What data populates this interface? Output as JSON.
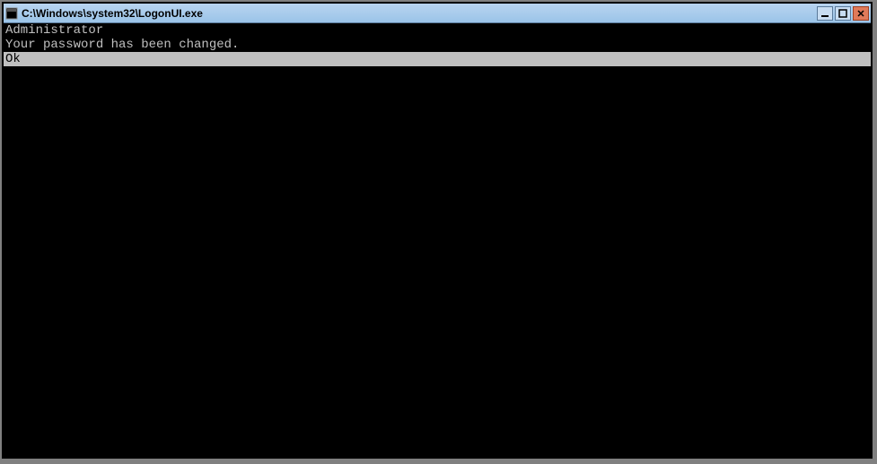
{
  "window": {
    "title": "C:\\Windows\\system32\\LogonUI.exe"
  },
  "console": {
    "lines": [
      {
        "text": "Administrator",
        "selected": false
      },
      {
        "text": "Your password has been changed.",
        "selected": false
      },
      {
        "text": "Ok",
        "selected": true
      }
    ]
  }
}
